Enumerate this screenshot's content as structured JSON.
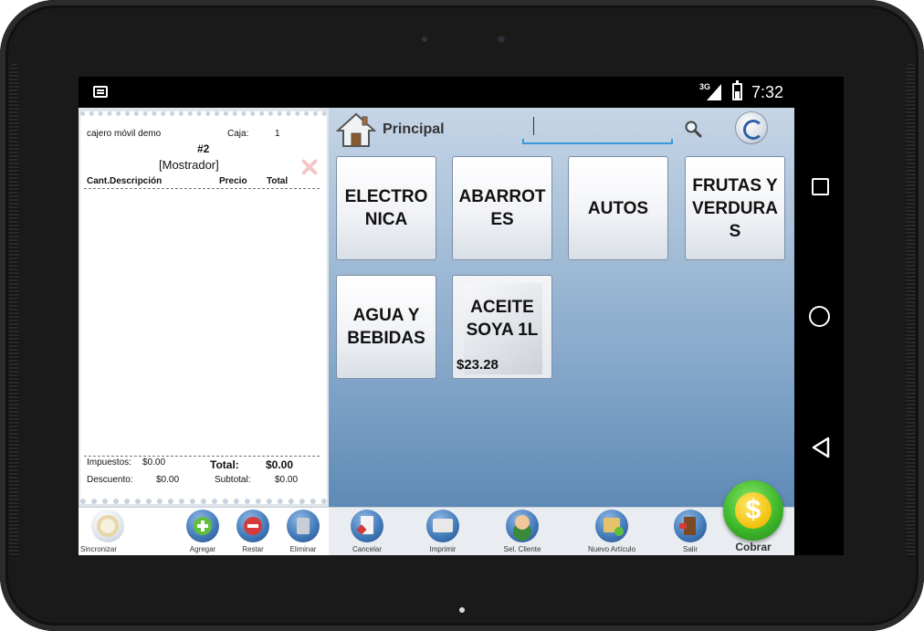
{
  "status_bar": {
    "network": "3G",
    "time": "7:32"
  },
  "receipt": {
    "user": "cajero móvil demo",
    "register_label": "Caja:",
    "register_value": "1",
    "ticket_number": "#2",
    "customer": "[Mostrador]",
    "columns": {
      "qty_desc": "Cant.Descripción",
      "price": "Precio",
      "total": "Total"
    },
    "taxes_label": "Impuestos:",
    "taxes_value": "$0.00",
    "total_label": "Total:",
    "total_value": "$0.00",
    "discount_label": "Descuento:",
    "discount_value": "$0.00",
    "subtotal_label": "Subtotal:",
    "subtotal_value": "$0.00"
  },
  "header": {
    "title": "Principal",
    "search_value": ""
  },
  "categories": [
    {
      "label": "ELECTRO NICA"
    },
    {
      "label": "ABARROT ES"
    },
    {
      "label": "AUTOS"
    },
    {
      "label": "FRUTAS Y VERDURA S"
    },
    {
      "label": "AGUA Y BEBIDAS"
    }
  ],
  "products": [
    {
      "label": "ACEITE SOYA 1L",
      "price": "$23.28"
    }
  ],
  "toolbar": {
    "sync": "Sincronizar",
    "add": "Agregar",
    "subtract": "Restar",
    "delete": "Eliminar",
    "cancel": "Cancelar",
    "print": "Imprimir",
    "select_client": "Sel. Cliente",
    "new_item": "Nuevo Artículo",
    "exit": "Salir",
    "charge": "Cobrar",
    "charge_symbol": "$"
  },
  "colors": {
    "accent": "#3a9ad8",
    "charge": "#3fb82a",
    "subtract": "#d63a3a"
  },
  "icons": [
    "home-icon",
    "search-icon",
    "sync-icon",
    "plus-icon",
    "minus-icon",
    "trash-icon",
    "cancel-doc-icon",
    "printer-icon",
    "client-icon",
    "new-item-icon",
    "exit-door-icon",
    "dollar-coin-icon",
    "close-icon"
  ]
}
